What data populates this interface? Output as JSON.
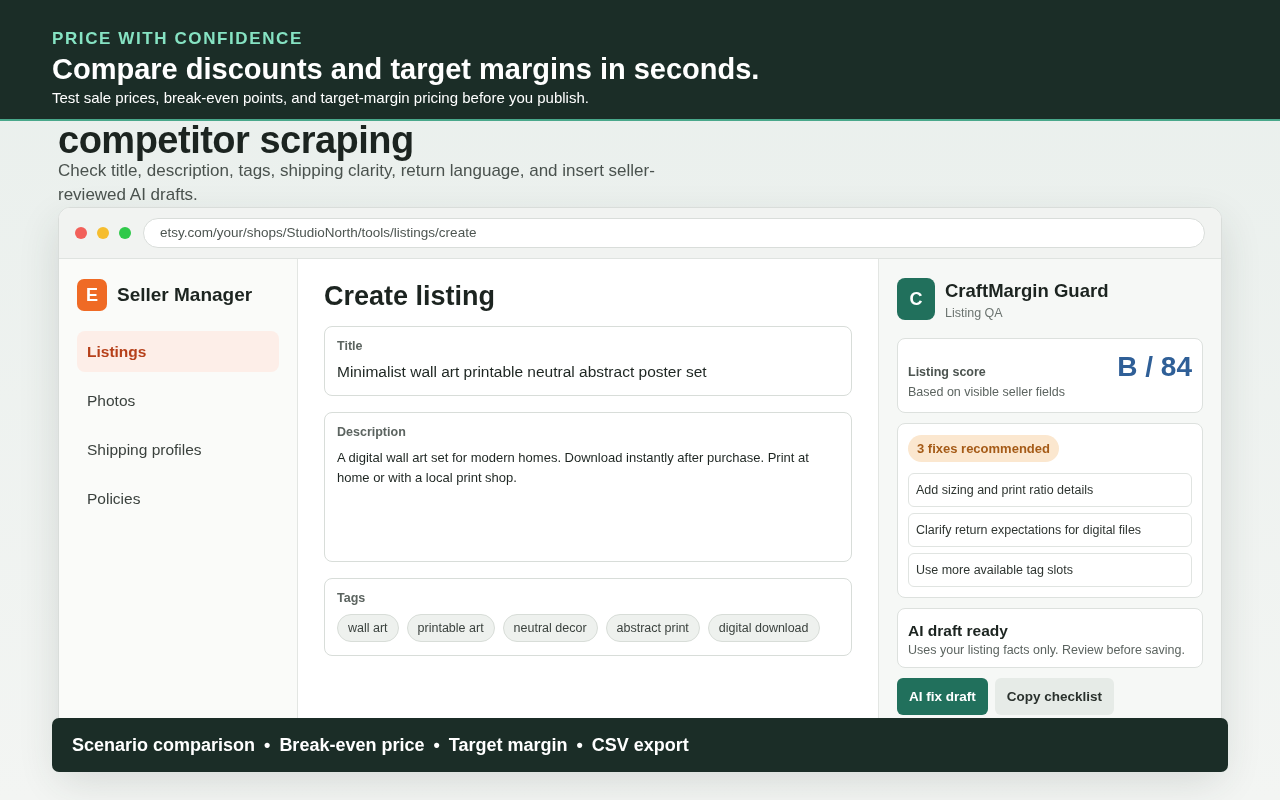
{
  "banner": {
    "eyebrow": "PRICE WITH CONFIDENCE",
    "title": "Compare discounts and target margins in seconds.",
    "subtitle": "Test sale prices, break-even points, and target-margin pricing before you publish."
  },
  "hero": {
    "heading": "competitor scraping",
    "description": "Check title, description, tags, shipping clarity, return language, and insert seller-reviewed AI drafts."
  },
  "browser": {
    "url": "etsy.com/your/shops/StudioNorth/tools/listings/create"
  },
  "sidebar": {
    "logo_letter": "E",
    "title": "Seller Manager",
    "items": [
      {
        "label": "Listings",
        "selected": true
      },
      {
        "label": "Photos",
        "selected": false
      },
      {
        "label": "Shipping profiles",
        "selected": false
      },
      {
        "label": "Policies",
        "selected": false
      }
    ]
  },
  "form": {
    "heading": "Create listing",
    "title_label": "Title",
    "title_value": "Minimalist wall art printable neutral abstract poster set",
    "description_label": "Description",
    "description_value": "A digital wall art set for modern homes. Download instantly after purchase. Print at home or with a local print shop.",
    "tags_label": "Tags",
    "tags": [
      "wall art",
      "printable art",
      "neutral decor",
      "abstract print",
      "digital download"
    ]
  },
  "panel": {
    "logo_letter": "C",
    "name": "CraftMargin Guard",
    "subtitle": "Listing QA",
    "score_label": "Listing score",
    "score_note": "Based on visible seller fields",
    "score": "B / 84",
    "fixes_badge": "3 fixes recommended",
    "fixes": [
      "Add sizing and print ratio details",
      "Clarify return expectations for digital files",
      "Use more available tag slots"
    ],
    "draft_title": "AI draft ready",
    "draft_note": "Uses your listing facts only. Review before saving.",
    "buttons": [
      {
        "label": "AI fix draft",
        "kind": "primary"
      },
      {
        "label": "Copy checklist",
        "kind": "secondary"
      }
    ]
  },
  "feature_bar": {
    "separator": "•",
    "items": [
      "Scenario comparison",
      "Break-even price",
      "Target margin",
      "CSV export"
    ]
  }
}
